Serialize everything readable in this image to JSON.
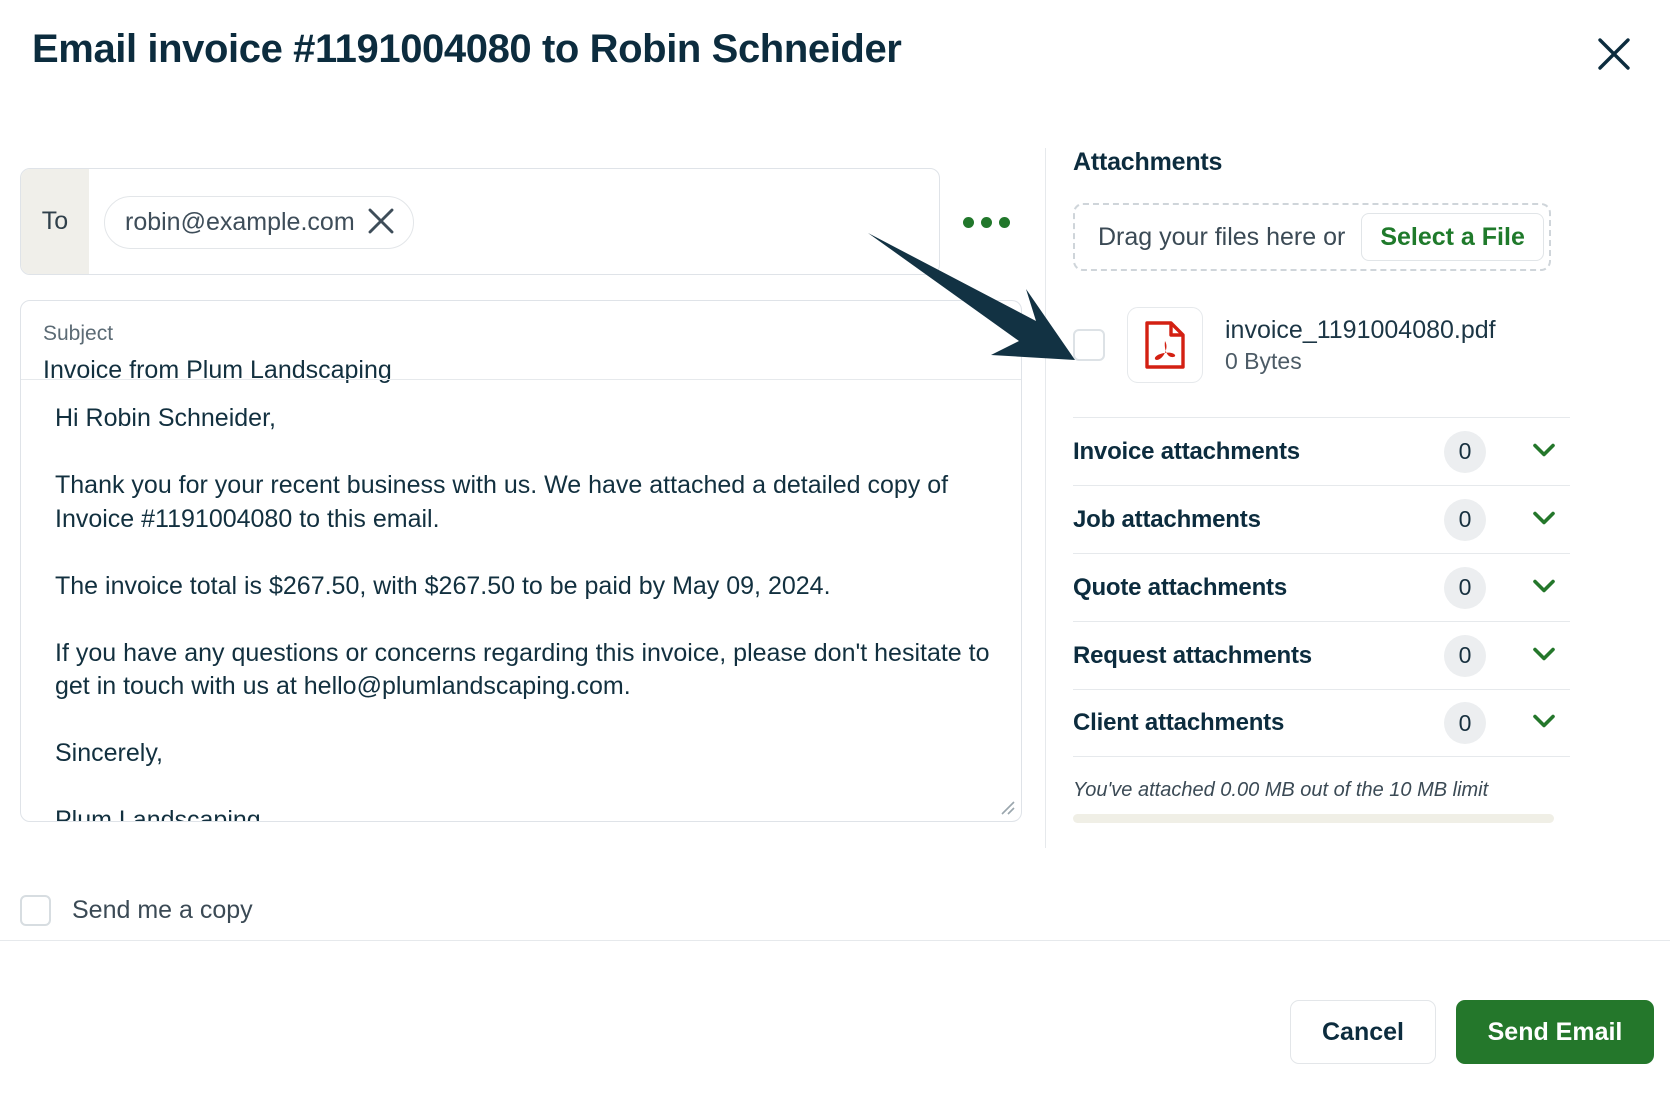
{
  "dialog": {
    "title": "Email invoice #1191004080 to Robin Schneider",
    "close_icon": "close-icon"
  },
  "compose": {
    "to_label": "To",
    "recipient": "robin@example.com",
    "remove_recipient_icon": "close-icon",
    "more_options_icon": "ellipsis-icon",
    "subject_label": "Subject",
    "subject_value": "Invoice from Plum Landscaping",
    "body": "Hi Robin Schneider,\n\nThank you for your recent business with us. We have attached a detailed copy of Invoice #1191004080 to this email.\n\nThe invoice total is $267.50, with $267.50 to be paid by May 09, 2024.\n\nIf you have any questions or concerns regarding this invoice, please don't hesitate to get in touch with us at hello@plumlandscaping.com.\n\nSincerely,\n\nPlum Landscaping",
    "send_copy_label": "Send me a copy",
    "send_copy_checked": false
  },
  "attachments": {
    "title": "Attachments",
    "dropzone_text": "Drag your files here or",
    "select_file_label": "Select a File",
    "file": {
      "name": "invoice_1191004080.pdf",
      "size": "0 Bytes",
      "icon": "pdf-file-icon",
      "checked": false
    },
    "groups": [
      {
        "label": "Invoice attachments",
        "count": "0"
      },
      {
        "label": "Job attachments",
        "count": "0"
      },
      {
        "label": "Quote attachments",
        "count": "0"
      },
      {
        "label": "Request attachments",
        "count": "0"
      },
      {
        "label": "Client attachments",
        "count": "0"
      }
    ],
    "limit_note": "You've attached 0.00 MB out of the 10 MB limit",
    "limit_progress_percent": 0
  },
  "footer": {
    "cancel_label": "Cancel",
    "send_label": "Send Email"
  },
  "colors": {
    "brand_green": "#24772b",
    "link_green": "#1f7a2b",
    "dark_navy": "#0c2c3e",
    "pdf_red": "#d32012",
    "annotation_arrow": "#123243"
  }
}
